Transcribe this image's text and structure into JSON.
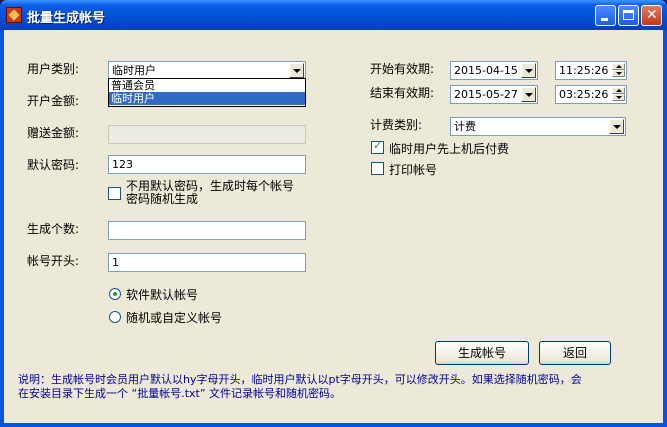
{
  "window": {
    "title": "批量生成帐号",
    "minimize_icon": "minimize-icon",
    "maximize_icon": "maximize-icon",
    "close_icon": "close-icon"
  },
  "left": {
    "user_type_label": "用户类别:",
    "user_type_value": "临时用户",
    "user_type_options": [
      "普通会员",
      "临时用户"
    ],
    "open_amount_label": "开户金额:",
    "bonus_amount_label": "赠送金额:",
    "bonus_amount_value": "",
    "default_password_label": "默认密码:",
    "default_password_value": "123",
    "no_default_password_label_line1": "不用默认密码，生成时每个帐号",
    "no_default_password_label_line2": "密码随机生成",
    "no_default_password_checked": false,
    "count_label": "生成个数:",
    "count_value": "",
    "prefix_label": "帐号开头:",
    "prefix_value": "1",
    "radio_software_default_label": "软件默认帐号",
    "radio_random_custom_label": "随机或自定义帐号",
    "selected_radio": "软件默认帐号"
  },
  "right": {
    "start_label": "开始有效期:",
    "start_date": "2015-04-15",
    "start_time": "11:25:26",
    "end_label": "结束有效期:",
    "end_date": "2015-05-27",
    "end_time": "03:25:26",
    "billing_type_label": "计费类别:",
    "billing_type_value": "计费",
    "postpay_label": "临时用户先上机后付费",
    "postpay_checked": true,
    "print_label": "打印帐号",
    "print_checked": false
  },
  "buttons": {
    "generate_label": "生成帐号",
    "back_label": "返回"
  },
  "note": {
    "line1": "说明：生成帐号时会员用户默认以hy字母开头，临时用户默认以pt字母开头，可以修改开头。如果选择随机密码，会",
    "line2": "在安装目录下生成一个 “批量帐号.txt” 文件记录帐号和随机密码。"
  },
  "colors": {
    "titlebar": "#0552d9",
    "dialog_bg": "#ece9d8",
    "selection": "#316ac5",
    "note_text": "#0000a0"
  }
}
